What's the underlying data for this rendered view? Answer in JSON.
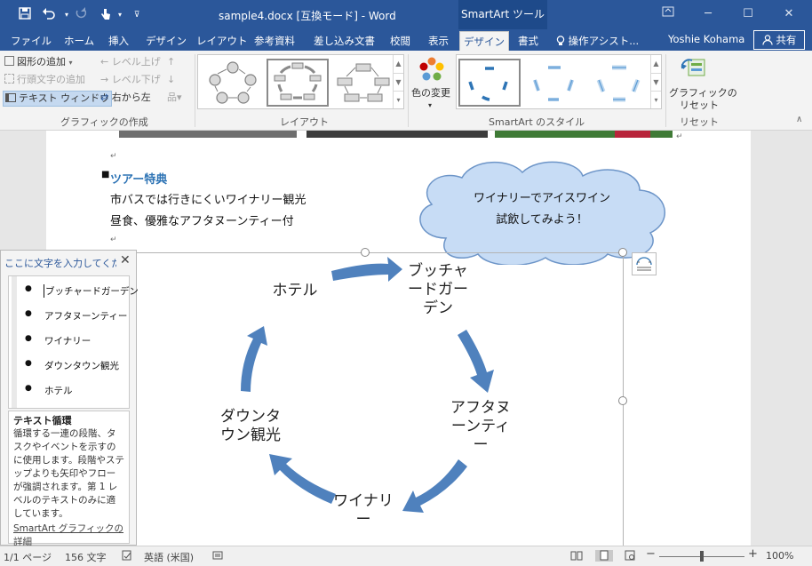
{
  "window": {
    "title": "sample4.docx [互換モード] - Word",
    "context_tools": "SmartArt ツール"
  },
  "tabs": [
    "ファイル",
    "ホーム",
    "挿入",
    "デザイン",
    "レイアウト",
    "参考資料",
    "差し込み文書",
    "校閲",
    "表示",
    "デザイン",
    "書式"
  ],
  "tell_me": "操作アシスト...",
  "user": {
    "name": "Yoshie Kohama",
    "share_label": "共有"
  },
  "ribbon": {
    "create_group": {
      "add_shape": "図形の追加",
      "add_bullet": "行頭文字の追加",
      "text_pane": "テキスト ウィンドウ",
      "promote": "レベル上げ",
      "demote": "レベル下げ",
      "right_to_left": "右から左",
      "label": "グラフィックの作成"
    },
    "layouts_label": "レイアウト",
    "change_colors": "色の変更",
    "styles_label": "SmartArt のスタイル",
    "reset_line1": "グラフィックの",
    "reset_line2": "リセット",
    "reset_group_label": "リセット"
  },
  "document": {
    "heading": "ツアー特典",
    "line1": "市バスでは行きにくいワイナリー観光",
    "line2": "昼食、優雅なアフタヌーンティー付"
  },
  "cloud": {
    "line1": "ワイナリーでアイスワイン",
    "line2": "試飲してみよう！"
  },
  "smartart": {
    "nodes": [
      "ブッチャードガーデン",
      "アフタヌーンティー",
      "ワイナリー",
      "ダウンタウン観光",
      "ホテル"
    ],
    "node_lines": [
      [
        "ブッチャ",
        "ードガー",
        "デン"
      ],
      [
        "アフタヌ",
        "ーンティ",
        "ー"
      ],
      [
        "ワイナリ",
        "ー"
      ],
      [
        "ダウンタ",
        "ウン観光"
      ]
    ]
  },
  "text_pane": {
    "title": "ここに文字を入力してくだ...",
    "items": [
      "ブッチャードガーデン",
      "アフタヌーンティー",
      "ワイナリー",
      "ダウンタウン観光",
      "ホテル"
    ],
    "desc_title": "テキスト循環",
    "desc_body": "循環する一連の段階、タスクやイベントを示すのに使用します。段階やステップよりも矢印やフローが強調されます。第 1 レベルのテキストのみに適しています。",
    "desc_link": "SmartArt グラフィックの詳細"
  },
  "status": {
    "page": "1/1 ページ",
    "words": "156 文字",
    "language": "英語 (米国)",
    "zoom_label": "100%",
    "zoom_percent": 100
  },
  "colors": {
    "title_bar": "#2b579a",
    "arrow_fill": "#4f81bd",
    "cloud_fill": "#c7dcf5",
    "heading_text": "#2e74b5"
  }
}
